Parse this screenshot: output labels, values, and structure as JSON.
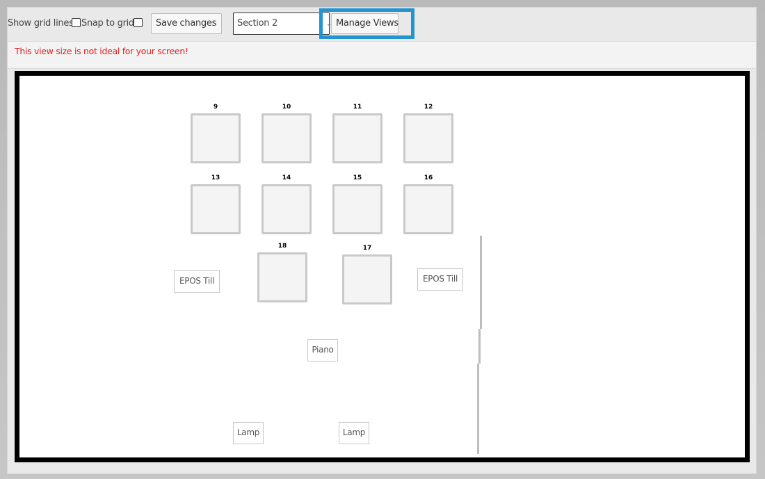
{
  "toolbar": {
    "show_grid_lines_label": "Show grid lines",
    "snap_to_grid_label": "Snap to grid",
    "save_changes_label": "Save changes",
    "section_select_value": "Section 2",
    "manage_views_label": "Manage Views"
  },
  "warning": {
    "text": "This view size is not ideal for your screen!"
  },
  "floor": {
    "tables": [
      "9",
      "10",
      "11",
      "12",
      "13",
      "14",
      "15",
      "16",
      "18",
      "17"
    ],
    "items": [
      "EPOS Till",
      "EPOS Till",
      "Piano",
      "Lamp",
      "Lamp"
    ]
  },
  "colors": {
    "highlight": "#2394d0",
    "warning": "#e42020"
  }
}
